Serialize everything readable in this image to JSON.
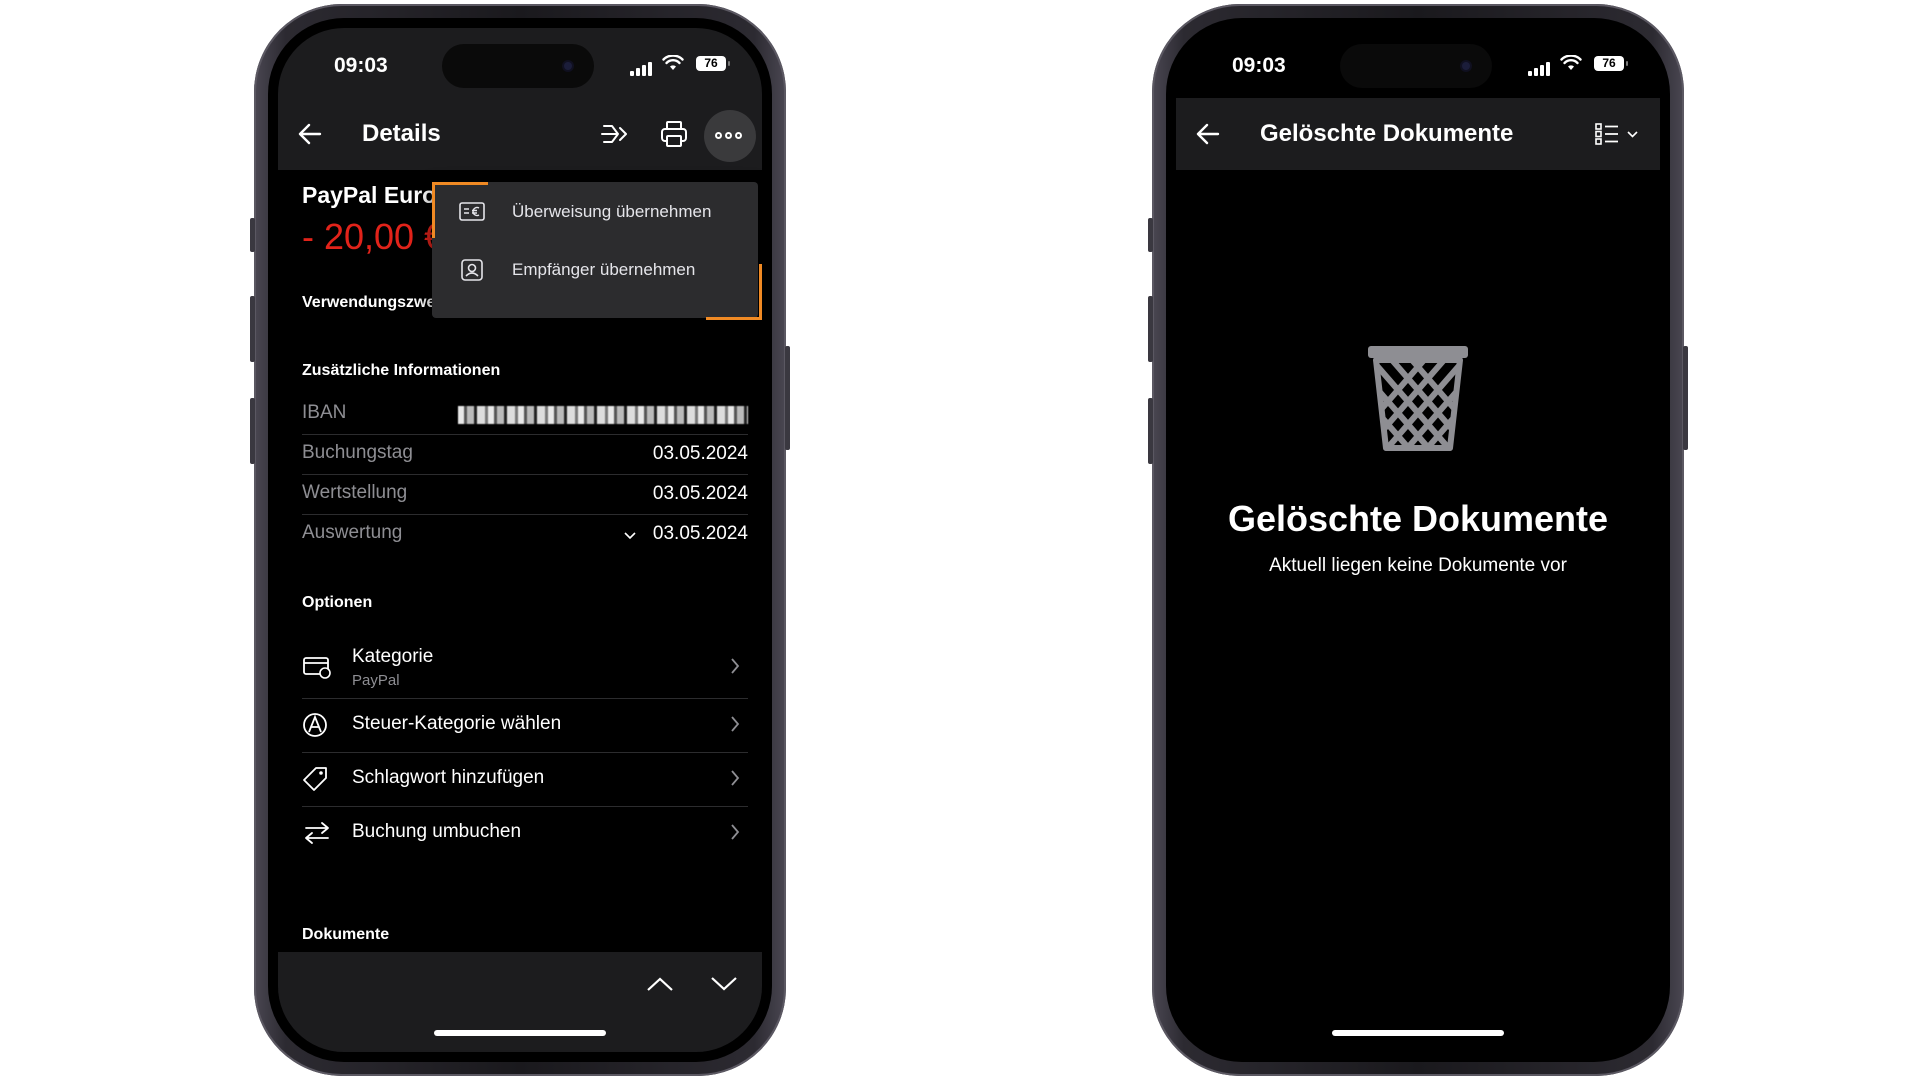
{
  "left_phone": {
    "status": {
      "time": "09:03",
      "battery": "76"
    },
    "header": {
      "title": "Details"
    },
    "transaction": {
      "payee": "PayPal Euro",
      "amount": "- 20,00 €"
    },
    "menu": {
      "items": [
        {
          "label": "Überweisung übernehmen"
        },
        {
          "label": "Empfänger übernehmen"
        }
      ],
      "highlight_color": "#f08a24"
    },
    "sections": {
      "purpose": "Verwendungszweck",
      "additional_info": "Zusätzliche Informationen",
      "options": "Optionen",
      "documents": "Dokumente"
    },
    "info_rows": [
      {
        "key": "IBAN",
        "value": ""
      },
      {
        "key": "Buchungstag",
        "value": "03.05.2024"
      },
      {
        "key": "Wertstellung",
        "value": "03.05.2024"
      },
      {
        "key": "Auswertung",
        "value": "03.05.2024"
      }
    ],
    "options": [
      {
        "label": "Kategorie",
        "sub": "PayPal",
        "icon": "category-card-icon"
      },
      {
        "label": "Steuer-Kategorie wählen",
        "icon": "tax-category-icon"
      },
      {
        "label": "Schlagwort hinzufügen",
        "icon": "tag-icon"
      },
      {
        "label": "Buchung umbuchen",
        "icon": "transfer-arrows-icon"
      }
    ],
    "amount_color": "#e2231a"
  },
  "right_phone": {
    "status": {
      "time": "09:03",
      "battery": "76"
    },
    "header": {
      "title": "Gelöschte Dokumente"
    },
    "empty_state": {
      "title": "Gelöschte Dokumente",
      "text": "Aktuell liegen keine Dokumente vor"
    }
  }
}
